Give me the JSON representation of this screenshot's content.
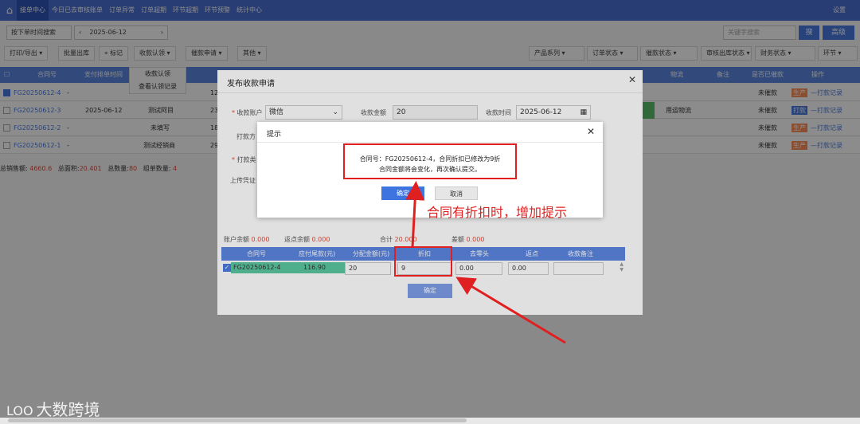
{
  "topnav": {
    "items": [
      "接单中心",
      "今日已去审核账单",
      "订单异常",
      "订单超期",
      "环节超期",
      "环节预警",
      "统计中心"
    ],
    "settings": "设置"
  },
  "toolbar1": {
    "date_filter": "按下单时间搜索",
    "date": "2025-06-12",
    "keyword_placeholder": "关键字搜索",
    "search": "搜",
    "advanced": "高级"
  },
  "toolbar2": {
    "items": [
      "打印/导出",
      "批量出库",
      "标记",
      "收款认领",
      "催款申请",
      "其他"
    ],
    "filters": [
      "产品系列",
      "订单状态",
      "催款状态",
      "审核出库状态",
      "财务状态",
      "环节"
    ]
  },
  "dropdown": {
    "items": [
      "收款认领",
      "查看认领记录"
    ]
  },
  "table": {
    "headers": [
      "合同号",
      "支付排单时间",
      "物流",
      "备注",
      "是否已催款",
      "操作"
    ],
    "rows": [
      {
        "contract": "FG20250612-4",
        "date": "-",
        "name": "",
        "num": "12",
        "status": "未催款",
        "op1": "生产",
        "op2": "打款记录"
      },
      {
        "contract": "FG20250612-3",
        "date": "2025-06-12",
        "name": "测试阿目",
        "num": "23",
        "logistics": "用运物流",
        "status": "未催款",
        "op1": "打款",
        "op2": "打款记录"
      },
      {
        "contract": "FG20250612-2",
        "date": "-",
        "name": "未填写",
        "num": "18",
        "status": "未催款",
        "op1": "生产",
        "op2": "打款记录"
      },
      {
        "contract": "FG20250612-1",
        "date": "-",
        "name": "测试经销商",
        "num": "29",
        "status": "未催款",
        "op1": "生产",
        "op2": "打款记录"
      }
    ]
  },
  "summary": {
    "total_sales_label": "总销售额:",
    "total_sales": "4660.6",
    "total_area_label": "总面积:",
    "total_area": "20.401",
    "total_qty_label": "总数量:",
    "total_qty": "80",
    "group_qty_label": "组单数量:",
    "group_qty": "4"
  },
  "dialog": {
    "title": "发布收款申请",
    "account_label": "收款账户",
    "account_value": "微信",
    "amount_label": "收款金额",
    "amount_value": "20",
    "time_label": "收款时间",
    "time_value": "2025-06-12",
    "method_label": "打款方",
    "type_label": "打款类",
    "voucher_label": "上传凭证",
    "balance_label": "账户余额",
    "balance_value": "0.000",
    "rebate_label": "返点余额",
    "rebate_value": "0.000",
    "total_label": "合计",
    "total_value": "20.000",
    "diff_label": "差额",
    "diff_value": "0.000",
    "sub_headers": [
      "合同号",
      "应付尾款(元)",
      "分配金额(元)",
      "折扣",
      "去零头",
      "返点",
      "收款备注"
    ],
    "sub_row": {
      "contract": "FG20250612-4",
      "due": "116.90",
      "alloc": "20",
      "discount": "9",
      "round": "0.00",
      "rebate": "0.00",
      "note": ""
    },
    "confirm": "确定"
  },
  "prompt": {
    "title": "提示",
    "message_line1": "合同号：FG20250612-4，合同折扣已修改为9折",
    "message_line2": "合同金额将会变化，再次确认提交。",
    "ok": "确定",
    "cancel": "取消"
  },
  "annotation": {
    "note": "合同有折扣时，增加提示",
    "color": "#e02020"
  },
  "watermark": {
    "text": "大数跨境",
    "logo": "LOO"
  }
}
